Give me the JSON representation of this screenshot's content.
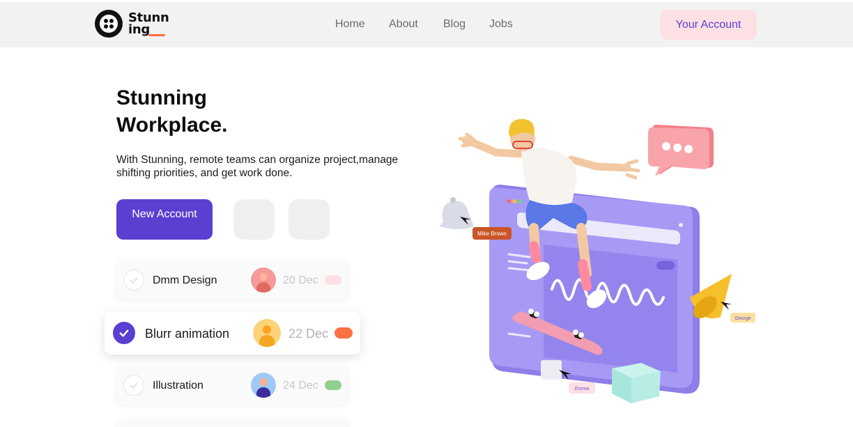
{
  "brand": {
    "name_line1": "Stunn",
    "name_line2": "ing",
    "accent": "#ff6a3d"
  },
  "nav": {
    "items": [
      {
        "label": "Home"
      },
      {
        "label": "About"
      },
      {
        "label": "Blog"
      },
      {
        "label": "Jobs"
      }
    ],
    "account_label": "Your Account"
  },
  "hero": {
    "title_line1": "Stunning",
    "title_line2": "Workplace.",
    "description": "With Stunning, remote teams can organize project,manage shifting priorities, and get work done.",
    "new_account_label": "New Account",
    "primary_color": "#5b3fd0"
  },
  "tasks": [
    {
      "name": "Dmm Design",
      "date": "20 Dec",
      "checked": false,
      "avatar_color": "#f59a96",
      "tag_color": "#fde0e4"
    },
    {
      "name": "Blurr animation",
      "date": "22 Dec",
      "checked": true,
      "avatar_color": "#fcd27a",
      "tag_color": "#ff7043"
    },
    {
      "name": "Illustration",
      "date": "24 Dec",
      "checked": false,
      "avatar_color": "#9fc8f5",
      "tag_color": "#8fd08c"
    }
  ],
  "illustration": {
    "labels": {
      "mike": "Mike Brown",
      "george": "George",
      "emma": "Emma"
    },
    "icons": [
      "skater-character",
      "browser-window",
      "chat-bubble-icon",
      "bell-icon",
      "cone-shape",
      "cube-shape",
      "skateboard",
      "cursor-icon"
    ]
  }
}
